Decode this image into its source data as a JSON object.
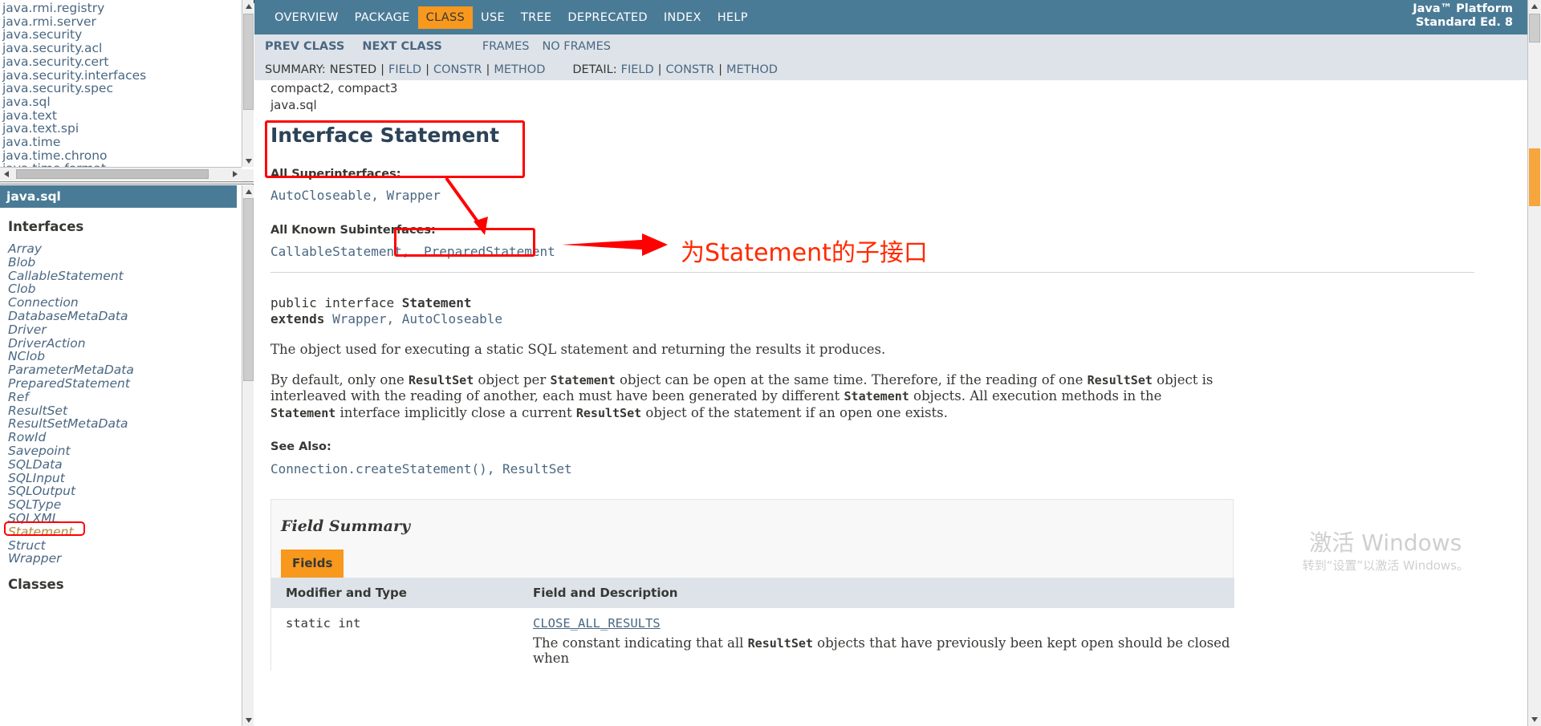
{
  "packages_frame": {
    "items": [
      "java.rmi.registry",
      "java.rmi.server",
      "java.security",
      "java.security.acl",
      "java.security.cert",
      "java.security.interfaces",
      "java.security.spec",
      "java.sql",
      "java.text",
      "java.text.spi",
      "java.time",
      "java.time.chrono",
      "java.time.format"
    ]
  },
  "class_frame": {
    "package_title": "java.sql",
    "sections": [
      {
        "heading": "Interfaces",
        "items": [
          "Array",
          "Blob",
          "CallableStatement",
          "Clob",
          "Connection",
          "DatabaseMetaData",
          "Driver",
          "DriverAction",
          "NClob",
          "ParameterMetaData",
          "PreparedStatement",
          "Ref",
          "ResultSet",
          "ResultSetMetaData",
          "RowId",
          "Savepoint",
          "SQLData",
          "SQLInput",
          "SQLOutput",
          "SQLType",
          "SQLXML",
          "Statement",
          "Struct",
          "Wrapper"
        ],
        "selected": "Statement"
      },
      {
        "heading": "Classes",
        "items": []
      }
    ]
  },
  "topnav": {
    "items": [
      {
        "label": "OVERVIEW",
        "active": false
      },
      {
        "label": "PACKAGE",
        "active": false
      },
      {
        "label": "CLASS",
        "active": true
      },
      {
        "label": "USE",
        "active": false
      },
      {
        "label": "TREE",
        "active": false
      },
      {
        "label": "DEPRECATED",
        "active": false
      },
      {
        "label": "INDEX",
        "active": false
      },
      {
        "label": "HELP",
        "active": false
      }
    ],
    "brand_line1": "Java™ Platform",
    "brand_line2": "Standard Ed. 8"
  },
  "subnav": {
    "prev_class": "PREV CLASS",
    "next_class": "NEXT CLASS",
    "frames": "FRAMES",
    "no_frames": "NO FRAMES"
  },
  "summary_nav": {
    "summary_label": "SUMMARY:",
    "summary_items": [
      "NESTED",
      "FIELD",
      "CONSTR",
      "METHOD"
    ],
    "detail_label": "DETAIL:",
    "detail_items": [
      "FIELD",
      "CONSTR",
      "METHOD"
    ],
    "separator": "|"
  },
  "doc": {
    "profile_line": "compact2, compact3",
    "package_line": "java.sql",
    "title": "Interface Statement",
    "superinterfaces_label": "All Superinterfaces:",
    "superinterfaces": "AutoCloseable, Wrapper",
    "subinterfaces_label": "All Known Subinterfaces:",
    "subinterfaces_prefix": "CallableStatement,",
    "subinterfaces_boxed": "PreparedStatement",
    "signature_line1_pre": "public interface ",
    "signature_line1_name": "Statement",
    "signature_line2_pre": "extends ",
    "signature_line2_rest": "Wrapper, AutoCloseable",
    "desc1": "The object used for executing a static SQL statement and returning the results it produces.",
    "desc2_a": "By default, only one ",
    "desc2_code1": "ResultSet",
    "desc2_b": " object per ",
    "desc2_code2": "Statement",
    "desc2_c": " object can be open at the same time. Therefore, if the reading of one ",
    "desc2_code3": "ResultSet",
    "desc2_d": " object is interleaved with the reading of another, each must have been generated by different ",
    "desc2_code4": "Statement",
    "desc2_e": " objects. All execution methods in the ",
    "desc2_code5": "Statement",
    "desc2_f": " interface implicitly close a current ",
    "desc2_code6": "ResultSet",
    "desc2_g": " object of the statement if an open one exists.",
    "see_also_label": "See Also:",
    "see_also": "Connection.createStatement(), ResultSet"
  },
  "field_summary": {
    "heading": "Field Summary",
    "tab_label": "Fields",
    "columns": [
      "Modifier and Type",
      "Field and Description"
    ],
    "rows": [
      {
        "modifier_and_type": "static int",
        "field_name": "CLOSE_ALL_RESULTS",
        "description_a": "The constant indicating that all ",
        "description_code": "ResultSet",
        "description_b": " objects that have previously been kept open should be closed when"
      }
    ]
  },
  "annotations": {
    "arrow_note": "为Statement的子接口",
    "highlight_color": "#ff0000"
  },
  "watermark": {
    "line1": "激活 Windows",
    "line2": "转到“设置”以激活 Windows。"
  }
}
